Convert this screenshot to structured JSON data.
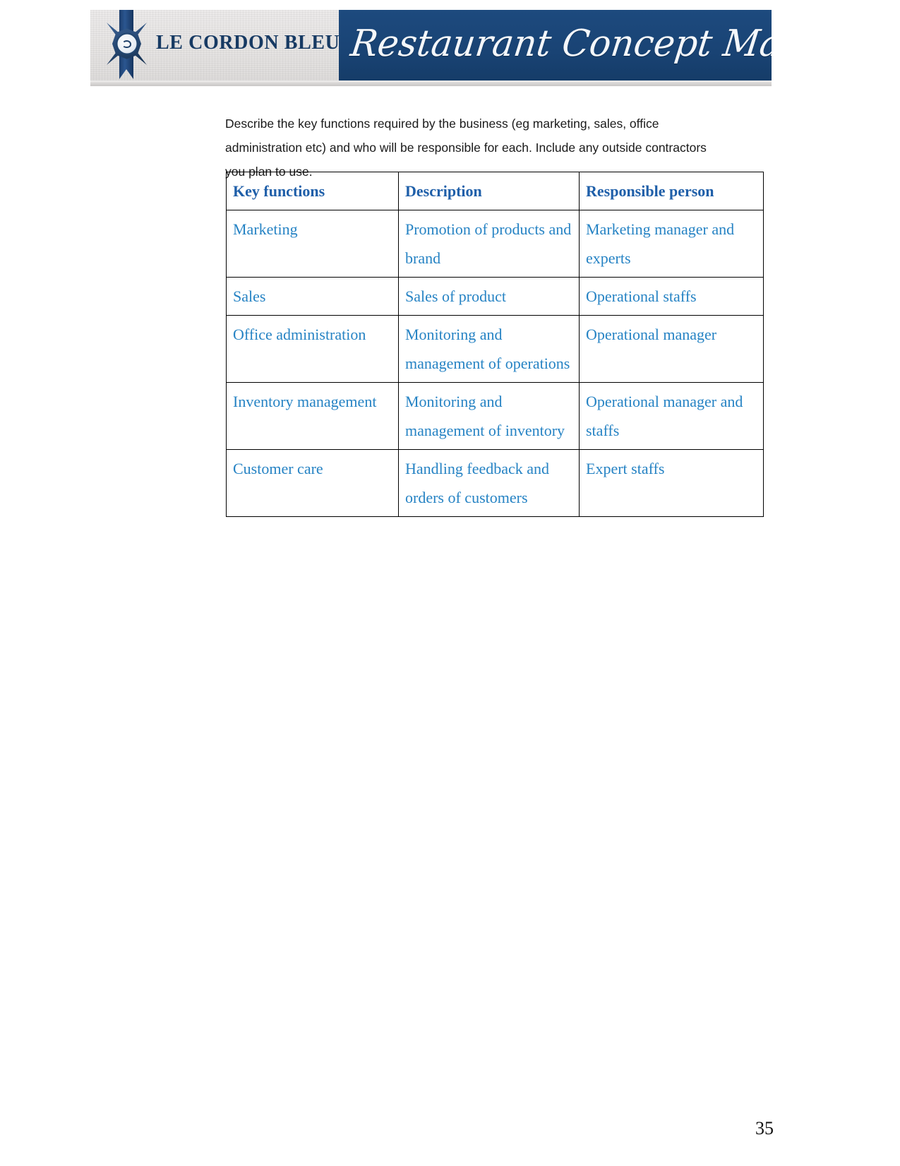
{
  "header": {
    "brand_name": "LE CORDON BLEU",
    "brand_registered_mark": "®",
    "banner_title": "Restaurant Concept Management",
    "emblem_icon": "le-cordon-bleu-crest-icon",
    "colors": {
      "banner_background": "#1b4578",
      "banner_text": "#f4f7fb",
      "brand_text": "#173a63",
      "plate_background": "#e8e6e5"
    }
  },
  "body": {
    "intro_paragraph": "Describe the key functions required by the business (eg marketing, sales, office administration etc) and who will be responsible for each.  Include any outside contractors you plan to use."
  },
  "table": {
    "colors": {
      "header_text": "#1f5fa9",
      "cell_text": "#2683c4",
      "border": "#000000"
    },
    "columns": [
      "Key functions",
      "Description",
      "Responsible person"
    ],
    "rows": [
      {
        "key_function": "Marketing",
        "description": "Promotion of products and brand",
        "responsible_person": "Marketing manager and experts"
      },
      {
        "key_function": "Sales",
        "description": "Sales of product",
        "responsible_person": "Operational staffs"
      },
      {
        "key_function": "Office administration",
        "description": "Monitoring and management of operations",
        "responsible_person": "Operational manager"
      },
      {
        "key_function": "Inventory management",
        "description": "Monitoring and management of inventory",
        "responsible_person": "Operational manager and staffs"
      },
      {
        "key_function": "Customer care",
        "description": "Handling feedback and orders of customers",
        "responsible_person": "Expert staffs"
      }
    ]
  },
  "footer": {
    "page_number": "35"
  }
}
